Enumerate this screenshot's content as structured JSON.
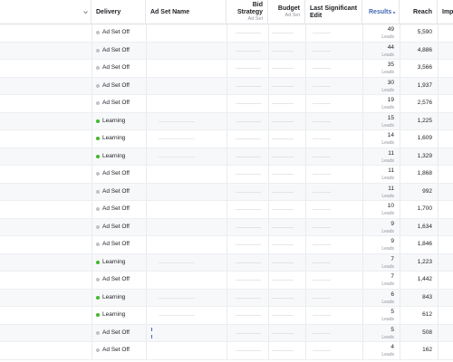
{
  "header": {
    "delivery": "Delivery",
    "ad_set_name": "Ad Set Name",
    "bid_strategy_line1": "Bid",
    "bid_strategy_line2": "Strategy",
    "bid_strategy_sub": "Ad Set",
    "budget": "Budget",
    "budget_sub": "Ad Set",
    "last_edit_line1": "Last Significant",
    "last_edit_line2": "Edit",
    "results": "Results",
    "results_sort_icon": "sort-desc-icon",
    "reach": "Reach",
    "impressions_truncated": "Imp"
  },
  "colors": {
    "learning": "#42b72a",
    "off": "#bec3c9",
    "results_header": "#4267b2"
  },
  "rows": [
    {
      "delivery": "Ad Set Off",
      "status": "off",
      "results": "49",
      "unit": "Leads",
      "reach": "5,590"
    },
    {
      "delivery": "Ad Set Off",
      "status": "off",
      "results": "44",
      "unit": "Leads",
      "reach": "4,886"
    },
    {
      "delivery": "Ad Set Off",
      "status": "off",
      "results": "35",
      "unit": "Leads",
      "reach": "3,566"
    },
    {
      "delivery": "Ad Set Off",
      "status": "off",
      "results": "30",
      "unit": "Leads",
      "reach": "1,937"
    },
    {
      "delivery": "Ad Set Off",
      "status": "off",
      "results": "19",
      "unit": "Leads",
      "reach": "2,576"
    },
    {
      "delivery": "Learning",
      "status": "learning",
      "results": "15",
      "unit": "Leads",
      "reach": "1,225"
    },
    {
      "delivery": "Learning",
      "status": "learning",
      "results": "14",
      "unit": "Leads",
      "reach": "1,609"
    },
    {
      "delivery": "Learning",
      "status": "learning",
      "results": "11",
      "unit": "Leads",
      "reach": "1,329"
    },
    {
      "delivery": "Ad Set Off",
      "status": "off",
      "results": "11",
      "unit": "Leads",
      "reach": "1,868"
    },
    {
      "delivery": "Ad Set Off",
      "status": "off",
      "results": "11",
      "unit": "Leads",
      "reach": "992"
    },
    {
      "delivery": "Ad Set Off",
      "status": "off",
      "results": "10",
      "unit": "Leads",
      "reach": "1,700"
    },
    {
      "delivery": "Ad Set Off",
      "status": "off",
      "results": "9",
      "unit": "Leads",
      "reach": "1,634"
    },
    {
      "delivery": "Ad Set Off",
      "status": "off",
      "results": "9",
      "unit": "Leads",
      "reach": "1,846"
    },
    {
      "delivery": "Learning",
      "status": "learning",
      "results": "7",
      "unit": "Leads",
      "reach": "1,223"
    },
    {
      "delivery": "Ad Set Off",
      "status": "off",
      "results": "7",
      "unit": "Leads",
      "reach": "1,442"
    },
    {
      "delivery": "Learning",
      "status": "learning",
      "results": "6",
      "unit": "Leads",
      "reach": "843"
    },
    {
      "delivery": "Learning",
      "status": "learning",
      "results": "5",
      "unit": "Leads",
      "reach": "612"
    },
    {
      "delivery": "Ad Set Off",
      "status": "off",
      "results": "5",
      "unit": "Leads",
      "reach": "508"
    },
    {
      "delivery": "Ad Set Off",
      "status": "off",
      "results": "4",
      "unit": "Leads",
      "reach": "162"
    }
  ]
}
